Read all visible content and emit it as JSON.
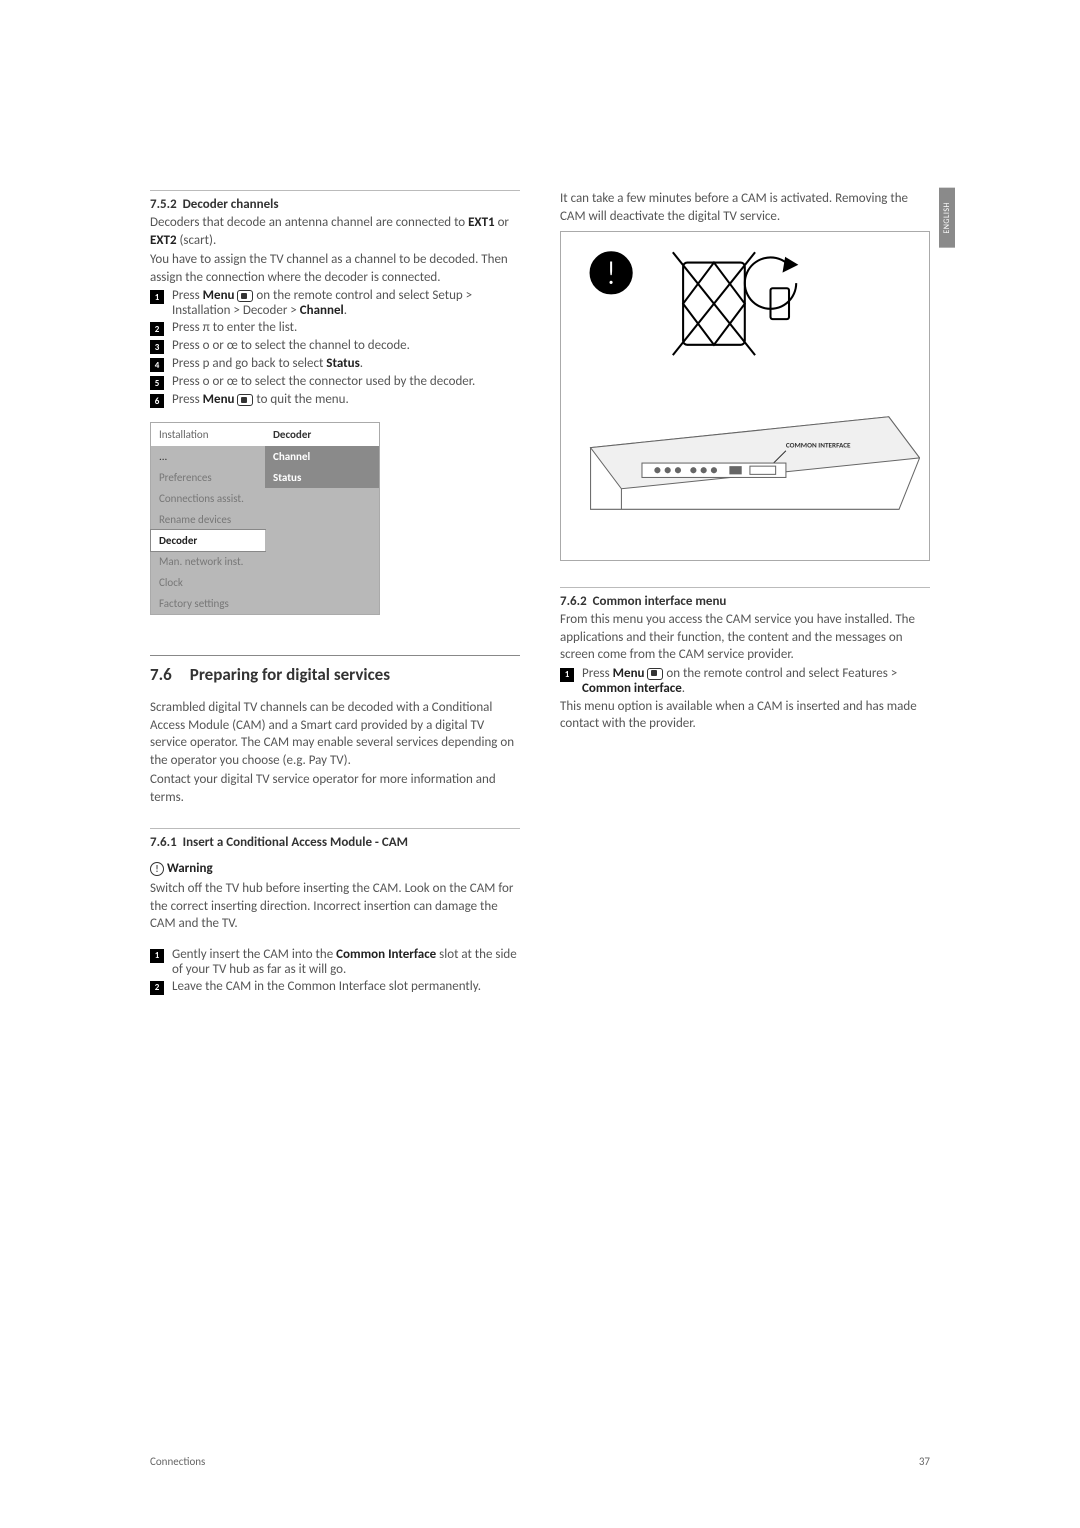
{
  "lang_tab": "ENGLISH",
  "left": {
    "s752": {
      "num": "7.5.2",
      "title": "Decoder channels",
      "p1a": "Decoders that decode an antenna channel are connected to ",
      "ext1": "EXT1",
      "p1b": " or ",
      "ext2": "EXT2",
      "p1c": " (scart).",
      "p2": "You have to assign the TV channel as a channel to be decoded. Then assign the connection where the decoder is connected.",
      "steps": [
        {
          "pre": "Press ",
          "b1": "Menu",
          "mid": " on the remote control and select Setup > Installation > Decoder > ",
          "b2": "Channel",
          "post": "."
        },
        {
          "pre": "Press π to enter the list."
        },
        {
          "pre": "Press o or œ to select the channel to decode."
        },
        {
          "pre": "Press p and go back to select ",
          "b1": "Status",
          "post": "."
        },
        {
          "pre": "Press o or œ to select the connector used by the decoder."
        },
        {
          "pre": "Press ",
          "b1": "Menu",
          "mid": " to quit the menu."
        }
      ],
      "menu": {
        "hdr_left": "Installation",
        "hdr_right": "Decoder",
        "rows": [
          {
            "l": "...",
            "r": "Channel",
            "cls": "darkhdr"
          },
          {
            "l": "Preferences",
            "r": "Status",
            "cls": "grey darkhdr2"
          },
          {
            "l": "Connections assist.",
            "r": "",
            "cls": "grey"
          },
          {
            "l": "Rename devices",
            "r": "",
            "cls": "grey"
          },
          {
            "l": "Decoder",
            "r": "",
            "cls": "sel"
          },
          {
            "l": "Man. network inst.",
            "r": "",
            "cls": "grey"
          },
          {
            "l": "Clock",
            "r": "",
            "cls": "grey"
          },
          {
            "l": "Factory settings",
            "r": "",
            "cls": "grey"
          }
        ]
      }
    },
    "s76": {
      "num": "7.6",
      "title": "Preparing for digital services",
      "p1": "Scrambled digital TV channels can be decoded with a Conditional Access Module (CAM) and a Smart card provided by a digital TV service operator. The CAM may enable several services depending on the operator you choose (e.g. Pay TV).",
      "p2": "Contact your digital TV service operator for more information and terms."
    },
    "s761": {
      "num": "7.6.1",
      "title": "Insert a Conditional Access Module - CAM",
      "warn_label": "Warning",
      "warn_text": "Switch off the TV hub before inserting the CAM. Look on the CAM for the correct inserting direction. Incorrect insertion can damage the CAM and the TV.",
      "steps": [
        {
          "pre": "Gently insert the CAM into the ",
          "b1": "Common Interface",
          "post": " slot at the side of your TV hub as far as it will go."
        },
        {
          "pre": "Leave the CAM in the Common Interface slot permanently."
        }
      ]
    }
  },
  "right": {
    "intro": "It can take a few minutes before a CAM is activated. Removing the CAM will deactivate the digital TV service.",
    "illus_label": "COMMON INTERFACE",
    "s762": {
      "num": "7.6.2",
      "title": "Common interface menu",
      "p1": "From this menu you access the CAM service you have installed. The applications and their function, the content and the messages on screen come from the CAM service provider.",
      "step": {
        "pre": "Press ",
        "b1": "Menu",
        "mid": " on the remote control and select Features > ",
        "b2": "Common interface",
        "post": "."
      },
      "p2": "This menu option is available when a CAM is inserted and has made contact with the provider."
    }
  },
  "footer": {
    "left": "Connections",
    "right": "37"
  }
}
